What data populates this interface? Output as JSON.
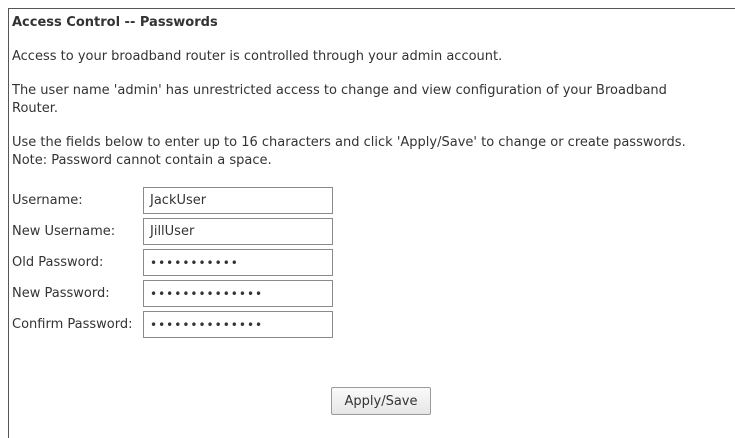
{
  "page": {
    "title": "Access Control -- Passwords",
    "intro": "Access to your broadband router is controlled through your admin account.",
    "admin_note": "The user name 'admin' has unrestricted access to change and view configuration of your Broadband Router.",
    "instructions_line1": "Use the fields below to enter up to 16 characters and click 'Apply/Save' to change or create passwords.",
    "instructions_line2": "Note: Password cannot contain a space."
  },
  "form": {
    "username_label": "Username:",
    "username_value": "JackUser",
    "new_username_label": "New Username:",
    "new_username_value": "JillUser",
    "old_password_label": "Old Password:",
    "old_password_mask": "•••••••••••",
    "new_password_label": "New Password:",
    "new_password_mask": "••••••••••••••",
    "confirm_password_label": "Confirm Password:",
    "confirm_password_mask": "••••••••••••••"
  },
  "actions": {
    "apply_save_label": "Apply/Save"
  }
}
